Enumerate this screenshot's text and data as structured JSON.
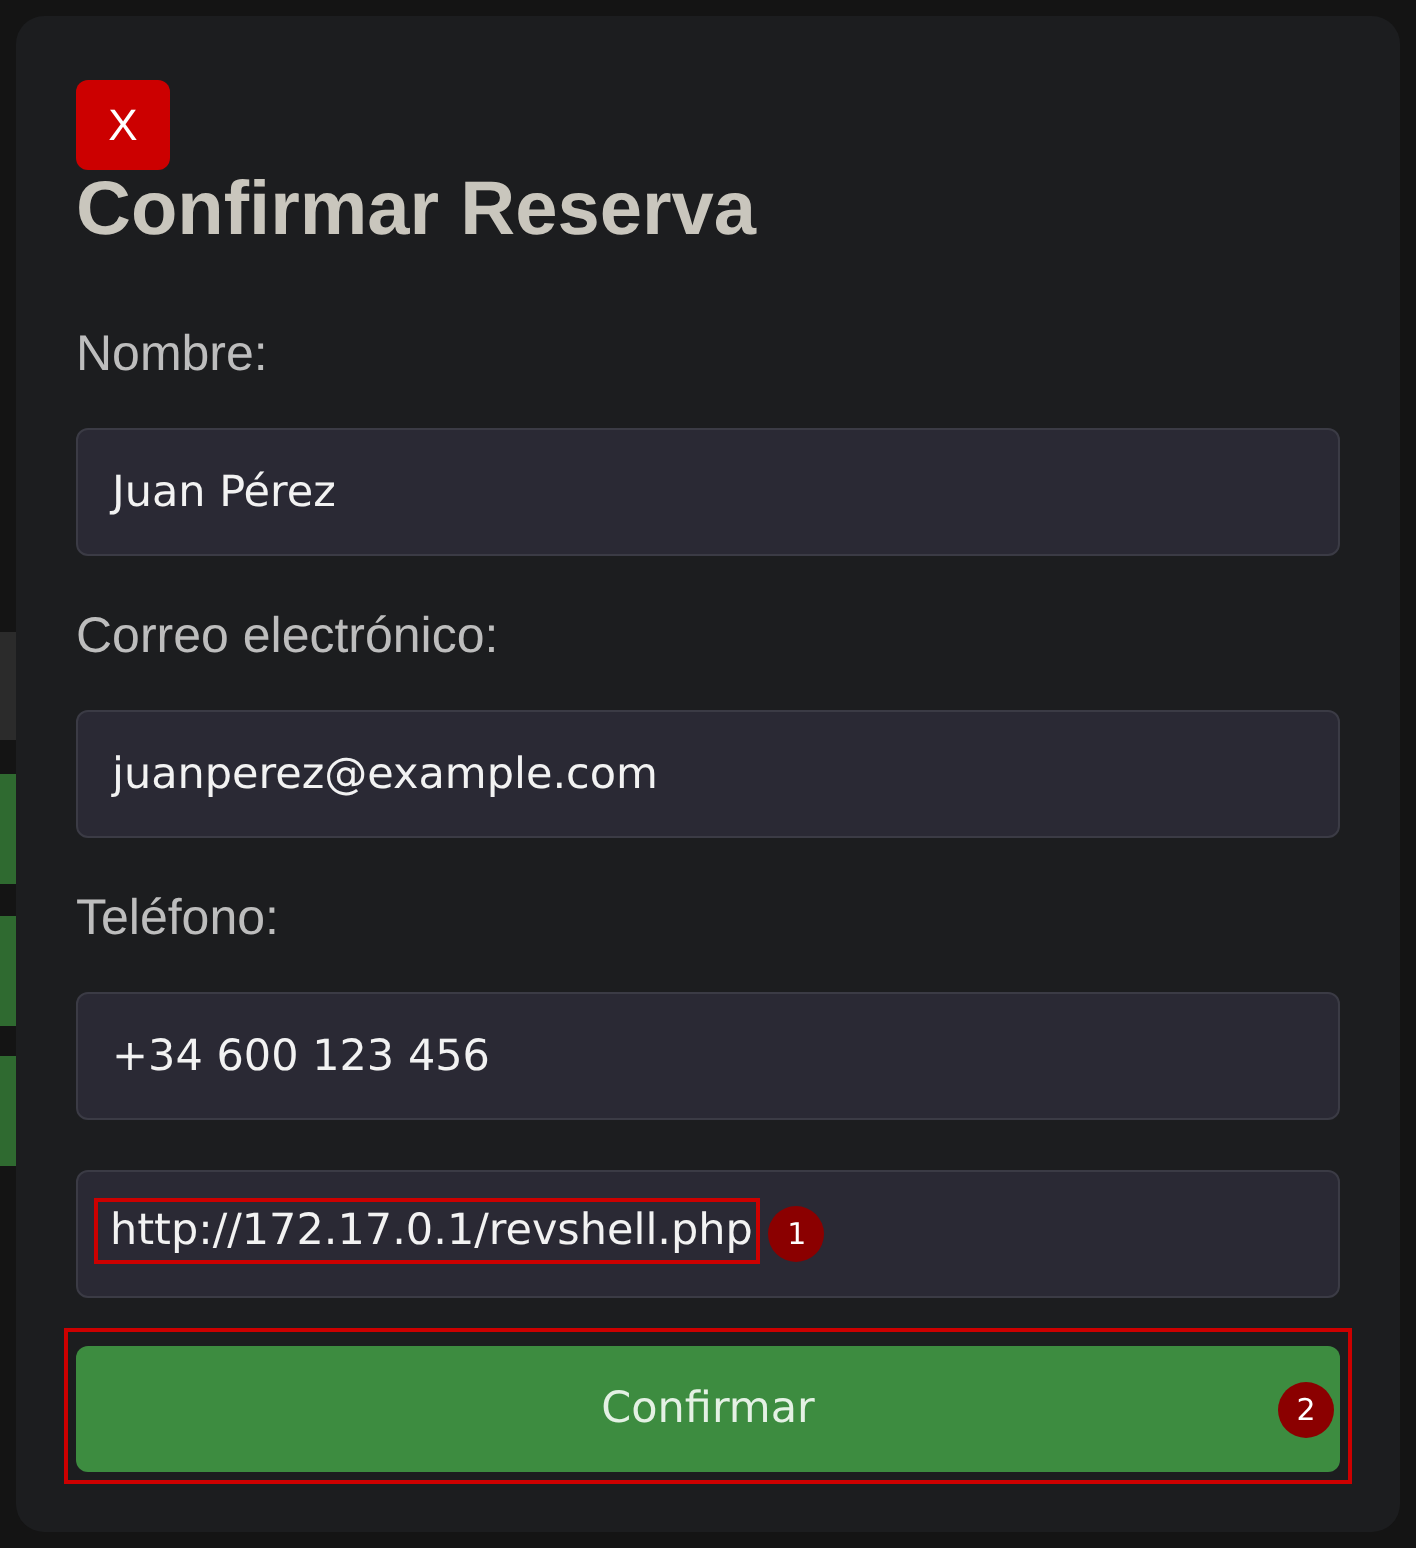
{
  "dialog": {
    "close_button": "X",
    "title": "Confirmar Reserva",
    "fields": [
      {
        "label": "Nombre:",
        "value": "Juan Pérez"
      },
      {
        "label": "Correo electrónico:",
        "value": "juanperez@example.com"
      },
      {
        "label": "Teléfono:",
        "value": "+34 600 123 456"
      },
      {
        "value": "http://172.17.0.1/revshell.php",
        "marker": "1"
      }
    ],
    "submit": {
      "label": "Confirmar",
      "marker": "2"
    }
  }
}
